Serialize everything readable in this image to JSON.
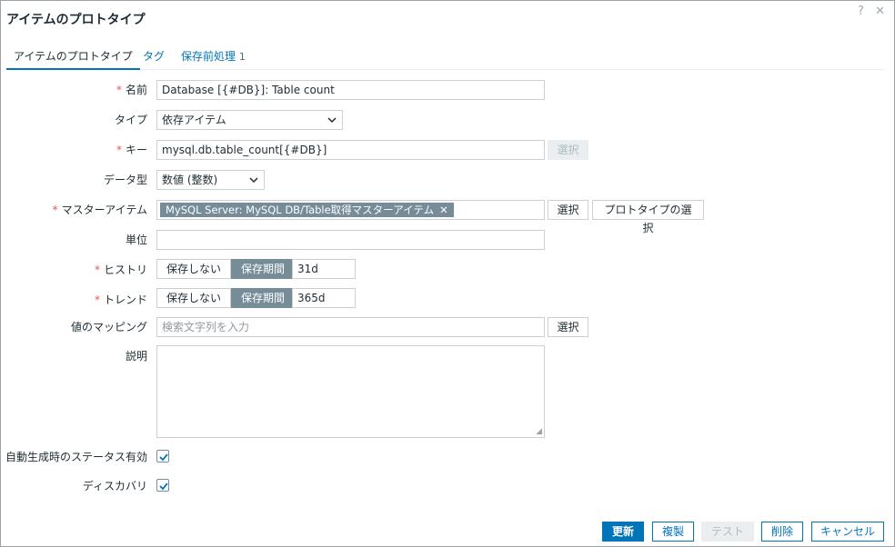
{
  "dialog": {
    "title": "アイテムのプロトタイプ",
    "help_icon": "?",
    "close_icon": "✕"
  },
  "tabs": [
    {
      "label": "アイテムのプロトタイプ"
    },
    {
      "label": "タグ"
    },
    {
      "label": "保存前処理",
      "badge": "1"
    }
  ],
  "form": {
    "name": {
      "label": "名前",
      "required": "*",
      "value": "Database [{#DB}]: Table count"
    },
    "type": {
      "label": "タイプ",
      "selected": "依存アイテム"
    },
    "key": {
      "label": "キー",
      "required": "*",
      "value": "mysql.db.table_count[{#DB}]",
      "button": "選択"
    },
    "data_type": {
      "label": "データ型",
      "selected": "数値 (整数)"
    },
    "master_item": {
      "label": "マスターアイテム",
      "required": "*",
      "chip": "MySQL Server: MySQL DB/Table取得マスターアイテム",
      "button_select": "選択",
      "button_prototype": "プロトタイプの選択"
    },
    "units": {
      "label": "単位",
      "value": ""
    },
    "history": {
      "label": "ヒストリ",
      "required": "*",
      "opt_off": "保存しない",
      "opt_on": "保存期間",
      "value": "31d"
    },
    "trends": {
      "label": "トレンド",
      "required": "*",
      "opt_off": "保存しない",
      "opt_on": "保存期間",
      "value": "365d"
    },
    "value_map": {
      "label": "値のマッピング",
      "placeholder": "検索文字列を入力",
      "button": "選択"
    },
    "description": {
      "label": "説明",
      "value": ""
    },
    "lld_status": {
      "label": "自動生成時のステータス有効",
      "checked": true
    },
    "discover": {
      "label": "ディスカバリ",
      "checked": true
    }
  },
  "footer": {
    "update": "更新",
    "clone": "複製",
    "test": "テスト",
    "delete": "削除",
    "cancel": "キャンセル"
  },
  "colors": {
    "accent": "#0275b8",
    "required": "#e45959",
    "chip": "#768d99"
  }
}
